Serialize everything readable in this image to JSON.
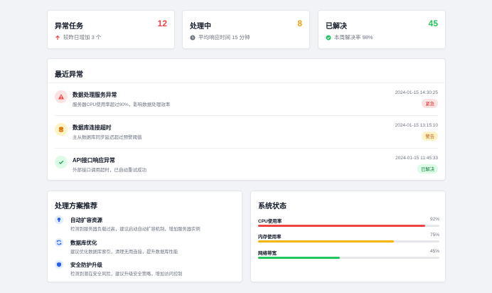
{
  "stats": [
    {
      "title": "异常任务",
      "value": "12",
      "value_color": "#ef4444",
      "sub": "较昨日增加 3 个",
      "icon": "arrow-up-icon",
      "icon_color": "#ef4444"
    },
    {
      "title": "处理中",
      "value": "8",
      "value_color": "#f59e0b",
      "sub": "平均响应时间 15 分钟",
      "icon": "clock-icon",
      "icon_color": "#6b7280"
    },
    {
      "title": "已解决",
      "value": "45",
      "value_color": "#22c55e",
      "sub": "本周解决率 98%",
      "icon": "check-circle-icon",
      "icon_color": "#22c55e"
    }
  ],
  "recent": {
    "title": "最近异常",
    "items": [
      {
        "title": "数据处理服务异常",
        "desc": "服务器CPU使用率超过90%，影响数据处理效率",
        "time": "2024-01-15 14:30:25",
        "tag": "紧急",
        "tag_bg": "#fde2e2",
        "tag_color": "#dc2626",
        "icon": "warning-icon",
        "icon_bg": "#fde2e2",
        "icon_color": "#ef4444"
      },
      {
        "title": "数据库连接超时",
        "desc": "主从数据库同步延迟超过预警阈值",
        "time": "2024-01-15 13:15:10",
        "tag": "警告",
        "tag_bg": "#fef3c7",
        "tag_color": "#b45309",
        "icon": "database-icon",
        "icon_bg": "#fef3c7",
        "icon_color": "#d97706"
      },
      {
        "title": "API接口响应异常",
        "desc": "外部接口调用超时，已自动重试成功",
        "time": "2024-01-15 11:45:33",
        "tag": "已解决",
        "tag_bg": "#dcfce7",
        "tag_color": "#15803d",
        "icon": "check-icon",
        "icon_bg": "#dcfce7",
        "icon_color": "#16a34a"
      }
    ]
  },
  "solutions": {
    "title": "处理方案推荐",
    "items": [
      {
        "title": "自动扩容资源",
        "desc": "检测到服务器负载过高，建议启动自动扩容机制，增加服务器实例",
        "icon": "lightbulb-icon"
      },
      {
        "title": "数据库优化",
        "desc": "建议优化数据库索引，清理无用连接，提升数据库性能",
        "icon": "sync-icon"
      },
      {
        "title": "安全防护升级",
        "desc": "检测到潜在安全风险，建议升级安全策略，增加访问控制",
        "icon": "shield-icon"
      }
    ]
  },
  "system": {
    "title": "系统状态",
    "metrics": [
      {
        "label": "CPU使用率",
        "value": "92%",
        "percent": 92,
        "color": "#ef4444"
      },
      {
        "label": "内存使用率",
        "value": "75%",
        "percent": 75,
        "color": "#f5b400"
      },
      {
        "label": "网络带宽",
        "value": "45%",
        "percent": 45,
        "color": "#22c55e"
      }
    ]
  }
}
